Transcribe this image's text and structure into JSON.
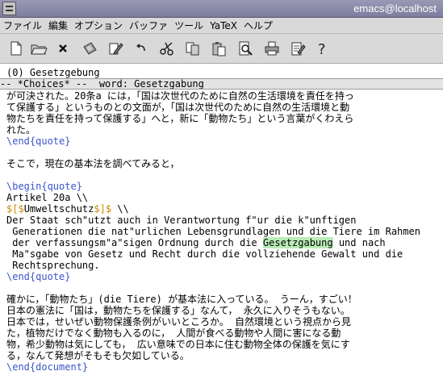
{
  "window": {
    "title": "emacs@localhost"
  },
  "menu": [
    "ファイル",
    "編集",
    "オプション",
    "バッファ",
    "ツール",
    "YaTeX",
    "ヘルプ"
  ],
  "toolbar": [
    "new-file",
    "open-folder",
    "close",
    "save-disk",
    "edit-pencil",
    "undo",
    "cut-scissors",
    "copy",
    "paste",
    "search-magnifier",
    "print",
    "preferences",
    "help-question"
  ],
  "echo": {
    "top": "(0) Gesetzgebung"
  },
  "modeline": {
    "text": "-- *Choices* --  word: Gesetzgabung"
  },
  "buffer": {
    "l1": "が可決された。20条a には，「国は次世代のために自然の生活環境を責任を持っ",
    "l2": "て保護する」というものとの文面が，「国は次世代のために自然の生活環境と動",
    "l3": "物たちを責任を持って保護する」へと，新に「動物たち」という言葉がくわえら",
    "l4": "れた。",
    "l5": "\\end{quote}",
    "l6": "そこで，現在の基本法を調べてみると，",
    "l7": "\\begin{quote}",
    "l8": "Artikel 20a \\\\",
    "l9_pre": "$[$",
    "l9_mid": "Umweltschutz",
    "l9_end": "$]$",
    "l9_tail": " \\\\",
    "l10": "Der Staat sch\"utzt auch in Verantwortung f\"ur die k\"unftigen",
    "l11": " Generationen die nat\"urlichen Lebensgrundlagen und die Tiere im Rahmen",
    "l12_pre": " der verfassungsm\"a\"sigen Ordnung durch die ",
    "l12_hl": "Gesetzgabung",
    "l12_post": " und nach",
    "l13": " Ma\"sgabe von Gesetz und Recht durch die vollziehende Gewalt und die",
    "l14": " Rechtsprechung.",
    "l15": "\\end{quote}",
    "l16": "確かに，「動物たち」(die Tiere) が基本法に入っている。 うーん，すごい！",
    "l17": "日本の憲法に「国は，動物たちを保護する」なんて， 永久に入りそうもない。",
    "l18": "日本では，せいぜい動物保護条例がいいところか。 自然環境という視点から見",
    "l19": "た，植物だけでなく動物も入るのに， 人間が食べる動物や人間に害になる動",
    "l20": "物，希少動物は気にしても， 広い意味での日本に住む動物全体の保護を気にす",
    "l21": "る，なんて発想がそもそも欠如している。",
    "l22": "\\end{document}"
  },
  "colors": {
    "keyword": "#3b55c8",
    "math": "#c98a00",
    "highlight": "#b9ecb6",
    "titlebar": "#8a8aa8"
  }
}
